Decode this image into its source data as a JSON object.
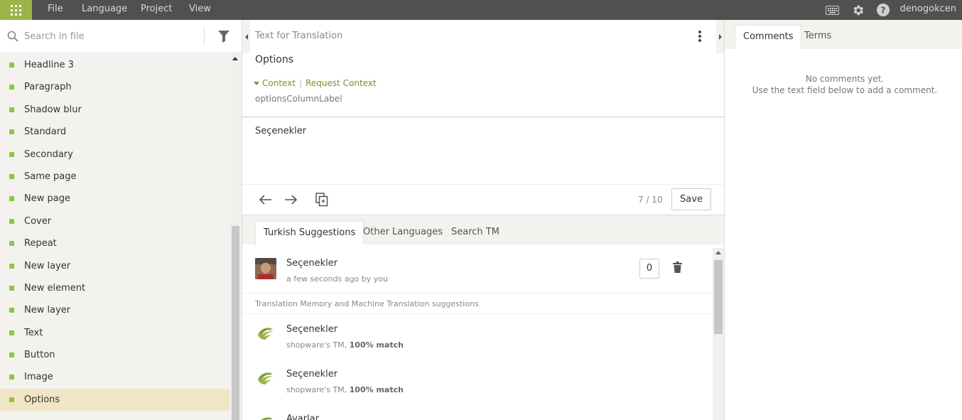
{
  "menu": {
    "apps_icon": "grid-icon",
    "items": [
      "File",
      "Language",
      "Project",
      "View"
    ]
  },
  "topbar": {
    "keyboard_icon": "keyboard-icon",
    "settings_icon": "gear-icon",
    "help_icon": "help-icon",
    "username": "denogokcen"
  },
  "sidebar": {
    "search_placeholder": "Search in file",
    "items": [
      {
        "label": "Headline 3"
      },
      {
        "label": "Paragraph"
      },
      {
        "label": "Shadow blur"
      },
      {
        "label": "Standard"
      },
      {
        "label": "Secondary"
      },
      {
        "label": "Same page"
      },
      {
        "label": "New page"
      },
      {
        "label": "Cover"
      },
      {
        "label": "Repeat"
      },
      {
        "label": "New layer"
      },
      {
        "label": "New element"
      },
      {
        "label": "New layer"
      },
      {
        "label": "Text"
      },
      {
        "label": "Button"
      },
      {
        "label": "Image"
      },
      {
        "label": "Options"
      }
    ],
    "active_item": "Options"
  },
  "editor": {
    "header_label": "Text for Translation",
    "source_text": "Options",
    "context_label": "Context",
    "request_context_label": "Request Context",
    "context_key": "optionsColumnLabel",
    "translation_text": "Seçenekler",
    "counter": "7 / 10",
    "save_label": "Save"
  },
  "suggestions": {
    "tabs": [
      "Turkish Suggestions",
      "Other Languages",
      "Search TM"
    ],
    "active_tab": "Turkish Suggestions",
    "own": {
      "text": "Seçenekler",
      "meta": "a few seconds ago by you",
      "votes": "0"
    },
    "tm_heading": "Translation Memory and Machine Translation suggestions",
    "tm_items": [
      {
        "text": "Seçenekler",
        "source": "shopware's TM, ",
        "match": "100% match"
      },
      {
        "text": "Seçenekler",
        "source": "shopware's TM, ",
        "match": "100% match"
      },
      {
        "text": "Avarlar",
        "source": "",
        "match": ""
      }
    ]
  },
  "right_panel": {
    "tabs": [
      "Comments",
      "Terms"
    ],
    "active_tab": "Comments",
    "empty_line1": "No comments yet.",
    "empty_line2": "Use the text field below to add a comment."
  },
  "colors": {
    "brand_green": "#9ab44a",
    "topbar": "#505050",
    "active_item": "#f0e6c6",
    "context_olive": "#8a8a2e"
  }
}
